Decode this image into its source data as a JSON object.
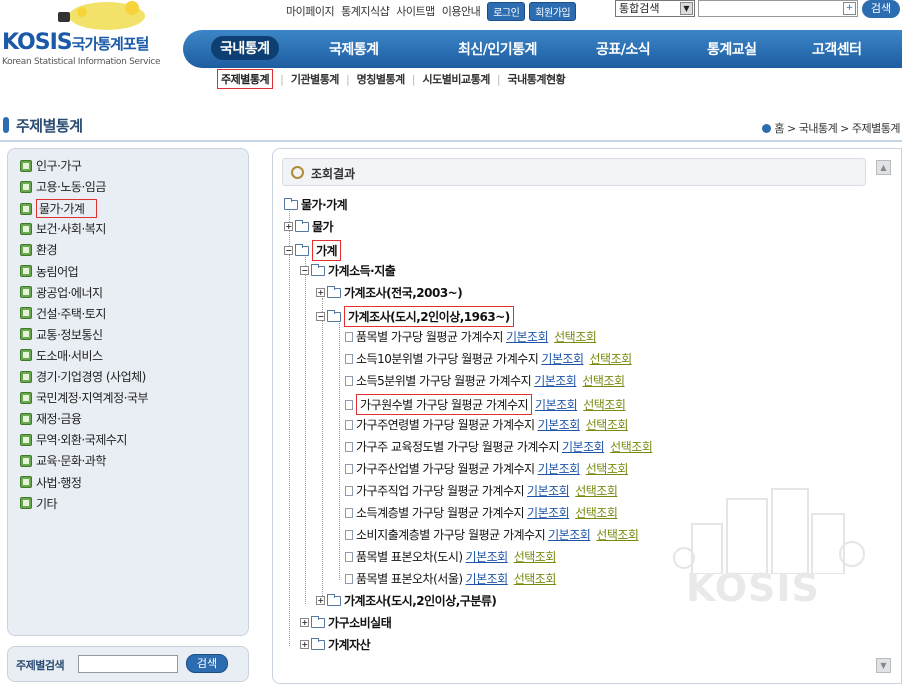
{
  "header": {
    "logo_kosis": "KOSIS",
    "logo_kr": "국가통계포털",
    "logo_en": "Korean Statistical Information Service",
    "util_links": [
      "마이페이지",
      "통계지식샵",
      "사이트맵",
      "이용안내"
    ],
    "login": "로그인",
    "signup": "회원가입",
    "search_scope": "통합검색",
    "search_button": "검색"
  },
  "gnb": {
    "items": [
      "국내통계",
      "국제통계",
      "최신/인기통계",
      "공표/소식",
      "통계교실",
      "고객센터"
    ],
    "active": "국내통계"
  },
  "lnb": {
    "items": [
      "주제별통계",
      "기관별통계",
      "명칭별통계",
      "시도별비교통계",
      "국내통계현황"
    ]
  },
  "page": {
    "title": "주제별통계",
    "breadcrumb": "홈 > 국내통계 > 주제별통계"
  },
  "sidebar": {
    "categories": [
      "인구·가구",
      "고용·노동·임금",
      "물가·가계",
      "보건·사회·복지",
      "환경",
      "농림어업",
      "광공업·에너지",
      "건설·주택·토지",
      "교통·정보통신",
      "도소매·서비스",
      "경기·기업경영 (사업체)",
      "국민계정·지역계정·국부",
      "재정·금융",
      "무역·외환·국제수지",
      "교육·문화·과학",
      "사법·행정",
      "기타"
    ],
    "selected": "물가·가계",
    "search_label": "주제별검색",
    "search_button": "검색"
  },
  "result": {
    "header": "조회결과",
    "root": "물가·가계",
    "level1": [
      "물가",
      "가계"
    ],
    "level2": [
      "가계소득·지출"
    ],
    "surveys": [
      "가계조사(전국,2003~)",
      "가계조사(도시,2인이상,1963~)",
      "가계조사(도시,2인이상,구분류)"
    ],
    "tables": [
      "품목별 가구당 월평균 가계수지",
      "소득10분위별 가구당 월평균 가계수지",
      "소득5분위별 가구당 월평균 가계수지",
      "가구원수별 가구당 월평균 가계수지",
      "가구주연령별 가구당 월평균 가계수지",
      "가구주 교육정도별 가구당 월평균 가계수지",
      "가구주산업별 가구당 월평균 가계수지",
      "가구주직업 가구당 월평균 가계수지",
      "소득계층별 가구당 월평균 가계수지",
      "소비지출계층별 가구당 월평균 가계수지",
      "품목별 표본오차(도시)",
      "품목별 표본오차(서울)"
    ],
    "link_basic": "기본조회",
    "link_select": "선택조회",
    "level1_tail": [
      "가구소비실태",
      "가계자산"
    ],
    "watermark": "KOSIS"
  }
}
